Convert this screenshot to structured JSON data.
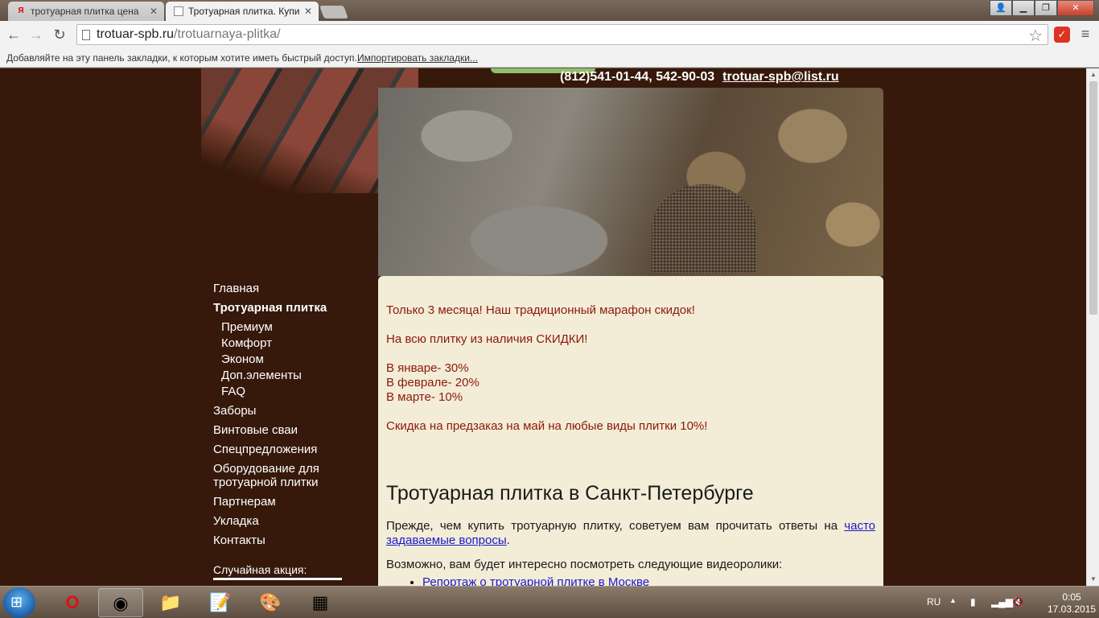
{
  "browser": {
    "tabs": [
      {
        "label": "тротуарная плитка цена",
        "favicon": "Я"
      },
      {
        "label": "Тротуарная плитка. Купи"
      }
    ],
    "url_domain": "trotuar-spb.ru",
    "url_path": "/trotuarnaya-plitka/",
    "bookmarks_hint": "Добавляйте на эту панель закладки, к которым хотите иметь быстрый доступ.",
    "bookmarks_import": "Импортировать закладки..."
  },
  "header": {
    "phones": "(812)541-01-44, 542-90-03",
    "email": "trotuar-spb@list.ru"
  },
  "nav": {
    "items": [
      {
        "label": "Главная"
      },
      {
        "label": "Тротуарная плитка"
      },
      {
        "label": "Заборы"
      },
      {
        "label": "Винтовые сваи"
      },
      {
        "label": "Спецпредложения"
      },
      {
        "label": "Оборудование для тротуарной плитки"
      },
      {
        "label": "Партнерам"
      },
      {
        "label": "Укладка"
      },
      {
        "label": "Контакты"
      }
    ],
    "subitems": [
      {
        "label": "Премиум"
      },
      {
        "label": "Комфорт"
      },
      {
        "label": "Эконом"
      },
      {
        "label": "Доп.элементы"
      },
      {
        "label": "FAQ"
      }
    ],
    "promo": "Случайная акция:"
  },
  "content": {
    "sale_lines": [
      "Только 3 месяца! Наш традиционный марафон скидок!",
      "На всю плитку из наличия СКИДКИ!",
      "В январе- 30%",
      "В феврале- 20%",
      "В марте- 10%",
      "Скидка на предзаказ на май на любые виды плитки 10%!"
    ],
    "heading": "Тротуарная плитка в Санкт-Петербурге",
    "intro_text": "Прежде, чем купить тротуарную плитку, советуем вам прочитать ответы на",
    "intro_link": "часто задаваемые вопросы",
    "intro_end": ".",
    "videos_title": "Возможно, вам будет интересно посмотреть следующие видеоролики:",
    "videos": [
      "Репортаж о тротуарной плитке в Москве"
    ]
  },
  "taskbar": {
    "lang": "RU",
    "time": "0:05",
    "date": "17.03.2015"
  }
}
